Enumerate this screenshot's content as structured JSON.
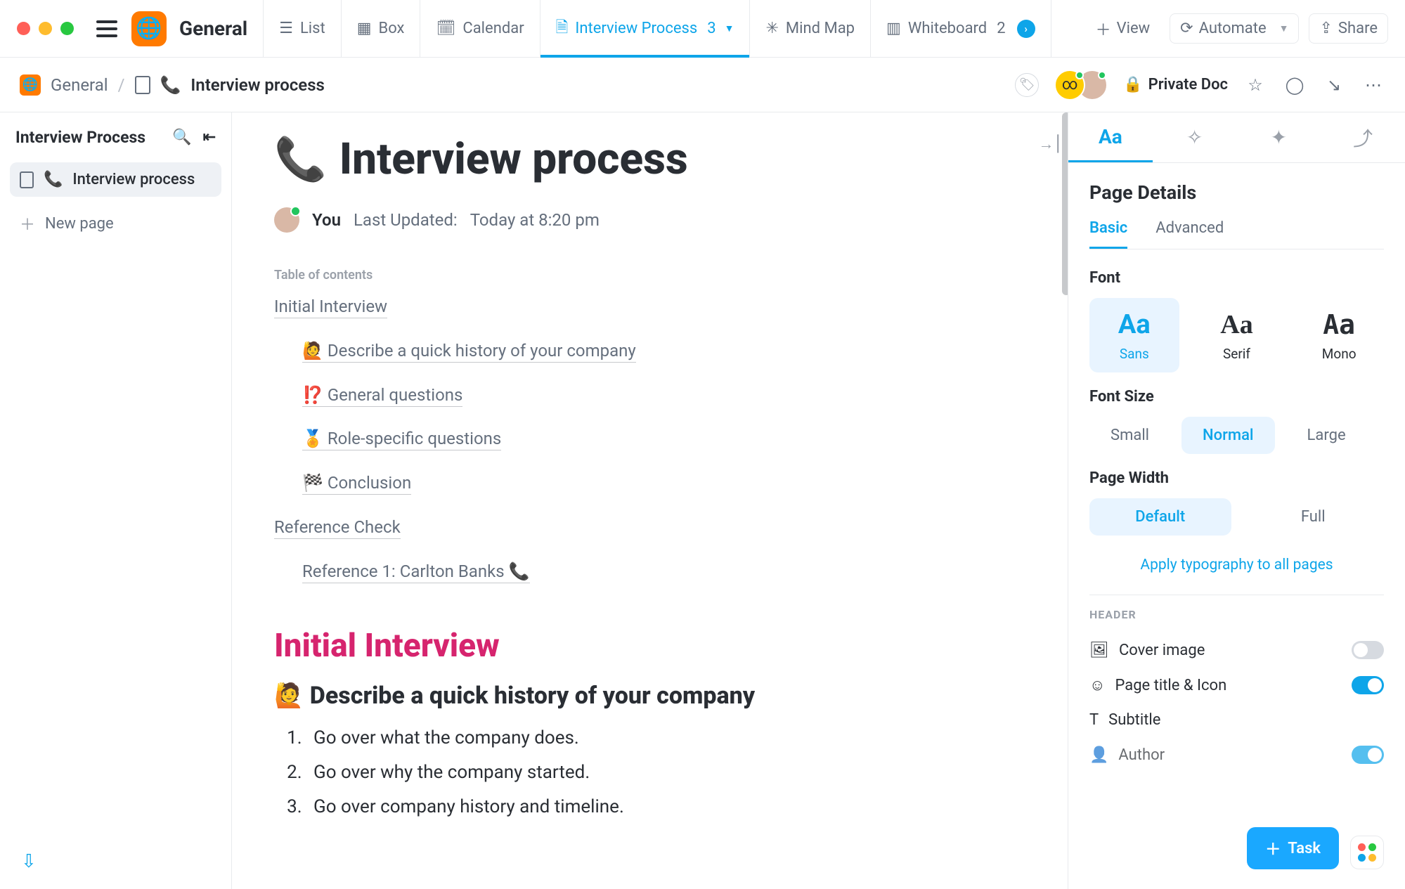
{
  "app": {
    "name": "General"
  },
  "views": {
    "list": {
      "label": "List"
    },
    "box": {
      "label": "Box"
    },
    "calendar": {
      "label": "Calendar"
    },
    "interview": {
      "label": "Interview Process",
      "count": "3"
    },
    "mindmap": {
      "label": "Mind Map"
    },
    "whiteboard": {
      "label": "Whiteboard",
      "count": "2"
    },
    "view": {
      "label": "View"
    },
    "automate": {
      "label": "Automate"
    },
    "share": {
      "label": "Share"
    }
  },
  "breadcrumb": {
    "root": "General",
    "page": "Interview process",
    "page_emoji": "📞",
    "privacy": "Private Doc"
  },
  "left": {
    "title": "Interview Process",
    "items": {
      "0": {
        "label": "Interview process",
        "emoji": "📞"
      }
    },
    "new_page": "New page"
  },
  "doc": {
    "emoji": "📞",
    "title": "Interview process",
    "author_label": "You",
    "updated_label": "Last Updated:",
    "updated_value": "Today at 8:20 pm",
    "toc_label": "Table of contents",
    "toc": {
      "0": {
        "label": "Initial Interview"
      },
      "1": {
        "label": "🙋 Describe a quick history of your company"
      },
      "2": {
        "label": "⁉️ General questions"
      },
      "3": {
        "label": "🏅 Role-specific questions"
      },
      "4": {
        "label": "🏁 Conclusion"
      },
      "5": {
        "label": "Reference Check"
      },
      "6": {
        "label": "Reference 1: Carlton Banks 📞"
      }
    },
    "h1": "Initial Interview",
    "h2": "🙋 Describe a quick history of your company",
    "steps": {
      "0": "Go over what the company does.",
      "1": "Go over why the company started.",
      "2": "Go over company history and timeline."
    }
  },
  "right": {
    "title": "Page Details",
    "tabs": {
      "basic": "Basic",
      "advanced": "Advanced"
    },
    "font_head": "Font",
    "fonts": {
      "sans": "Sans",
      "serif": "Serif",
      "mono": "Mono"
    },
    "fontsize_head": "Font Size",
    "sizes": {
      "small": "Small",
      "normal": "Normal",
      "large": "Large"
    },
    "width_head": "Page Width",
    "widths": {
      "def": "Default",
      "full": "Full"
    },
    "apply": "Apply typography to all pages",
    "header_label": "HEADER",
    "toggles": {
      "cover": "Cover image",
      "title": "Page title & Icon",
      "subtitle": "Subtitle",
      "author": "Author"
    }
  },
  "task_btn": "Task"
}
